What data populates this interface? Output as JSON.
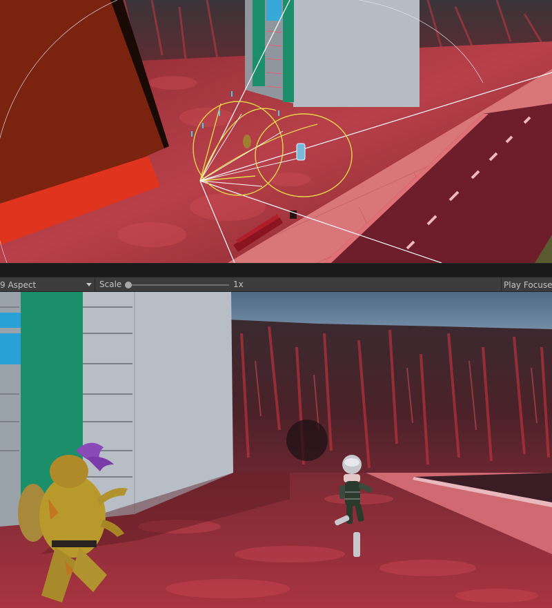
{
  "game_toolbar": {
    "aspect_label": "9 Aspect",
    "scale_label": "Scale",
    "scale_value": "1x",
    "scale_fraction": 0.0,
    "play_mode_label": "Play Focused"
  },
  "icons": {
    "aspect_dropdown": "chevron-down-icon"
  },
  "colors": {
    "toolbar_bg": "#3c3c3c",
    "editor_bg": "#1e1e1e",
    "gizmo_yellow": "#e8d84a",
    "camera_frustum": "#ffffff",
    "lava_ground": "#b8333c",
    "building_green": "#1a8f6a",
    "building_grey": "#b8bec6",
    "sky": "#5a7590"
  }
}
